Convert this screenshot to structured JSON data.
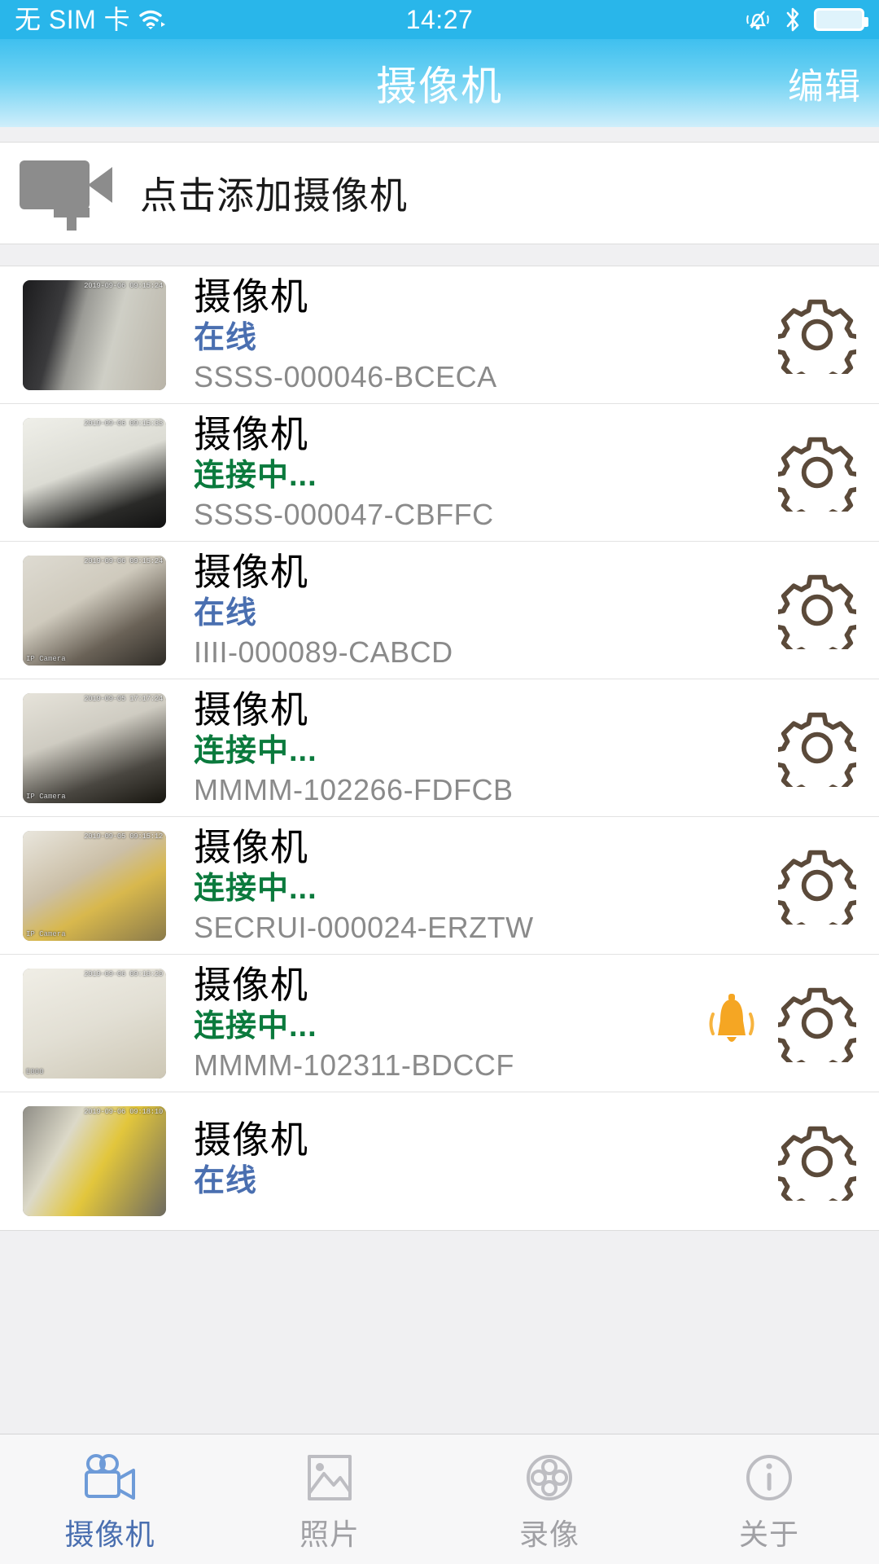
{
  "status_bar": {
    "carrier": "无 SIM 卡",
    "time": "14:27",
    "icons": [
      "wifi-icon",
      "silent-bell-icon",
      "bluetooth-icon",
      "battery-icon"
    ]
  },
  "nav": {
    "title": "摄像机",
    "edit_label": "编辑"
  },
  "add_camera": {
    "label": "点击添加摄像机",
    "icon": "video-camera-plus-icon"
  },
  "colors": {
    "accent": "#29b6ea",
    "nav_gradient_top": "#3fc0ef",
    "online": "#4a6fb0",
    "connecting": "#0b7a3d",
    "id_text": "#8a8a8a",
    "bell": "#f5a623",
    "gear": "#5b4a3a"
  },
  "cameras": [
    {
      "name": "摄像机",
      "status": "在线",
      "status_kind": "online",
      "id": "SSSS-000046-BCECA",
      "has_bell": false,
      "thumb_ts": "2019-09-06 09:15:24",
      "thumb_wm": ""
    },
    {
      "name": "摄像机",
      "status": "连接中...",
      "status_kind": "connecting",
      "id": "SSSS-000047-CBFFC",
      "has_bell": false,
      "thumb_ts": "2019-09-06 09:15:33",
      "thumb_wm": ""
    },
    {
      "name": "摄像机",
      "status": "在线",
      "status_kind": "online",
      "id": "IIII-000089-CABCD",
      "has_bell": false,
      "thumb_ts": "2019-09-06 09:15:24",
      "thumb_wm": "IP Camera"
    },
    {
      "name": "摄像机",
      "status": "连接中...",
      "status_kind": "connecting",
      "id": "MMMM-102266-FDFCB",
      "has_bell": false,
      "thumb_ts": "2019-09-05 17:17:24",
      "thumb_wm": "IP Camera"
    },
    {
      "name": "摄像机",
      "status": "连接中...",
      "status_kind": "connecting",
      "id": "SECRUI-000024-ERZTW",
      "has_bell": false,
      "thumb_ts": "2019-09-05 09:15:12",
      "thumb_wm": "IP Camera"
    },
    {
      "name": "摄像机",
      "status": "连接中...",
      "status_kind": "connecting",
      "id": "MMMM-102311-BDCCF",
      "has_bell": true,
      "thumb_ts": "2019-09-06 09:18:20",
      "thumb_wm": "E800"
    },
    {
      "name": "摄像机",
      "status": "在线",
      "status_kind": "online",
      "id": "",
      "has_bell": false,
      "thumb_ts": "2019-09-06 09:18:10",
      "thumb_wm": ""
    }
  ],
  "tabs": [
    {
      "label": "摄像机",
      "icon": "video-camera-icon",
      "active": true
    },
    {
      "label": "照片",
      "icon": "photo-icon",
      "active": false
    },
    {
      "label": "录像",
      "icon": "film-reel-icon",
      "active": false
    },
    {
      "label": "关于",
      "icon": "info-icon",
      "active": false
    }
  ]
}
